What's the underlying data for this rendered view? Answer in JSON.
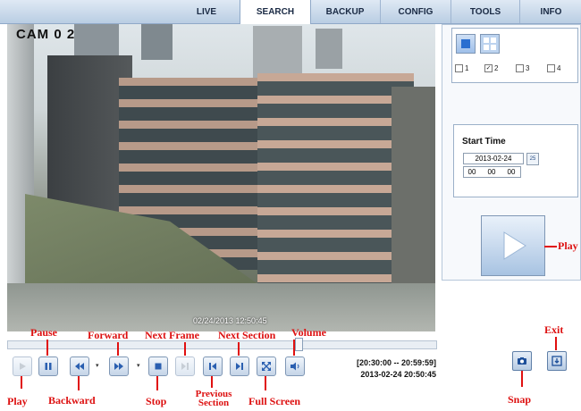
{
  "nav": {
    "tabs": [
      "LIVE",
      "SEARCH",
      "BACKUP",
      "CONFIG",
      "TOOLS",
      "INFO"
    ],
    "active": "SEARCH"
  },
  "video": {
    "camera": "CAM 0 2",
    "overlay_timestamp": "02/24/2013 12:50:45"
  },
  "playback": {
    "range": "[20:30:00 -- 20:59:59]",
    "datetime": "2013-02-24 20:50:45",
    "seek_position": 0.67
  },
  "channels": [
    {
      "label": "1",
      "checked": false
    },
    {
      "label": "2",
      "checked": true
    },
    {
      "label": "3",
      "checked": false
    },
    {
      "label": "4",
      "checked": false
    }
  ],
  "start_time": {
    "label": "Start Time",
    "date": "2013-02-24",
    "hours": "00",
    "minutes": "00",
    "seconds": "00",
    "calendar_day": "25"
  },
  "annotations": {
    "pause": "Pause",
    "forward": "Forward",
    "next_frame": "Next Frame",
    "next_section": "Next Section",
    "volume": "Volume",
    "play": "Play",
    "backward": "Backward",
    "stop": "Stop",
    "previous_section": "Previous Section",
    "full_screen": "Full Screen",
    "snap": "Snap",
    "exit": "Exit",
    "play_right": "Play"
  },
  "colors": {
    "annotation": "#dd1111",
    "accent": "#2a6fd0",
    "nav_bg": "#c9d9ec"
  }
}
